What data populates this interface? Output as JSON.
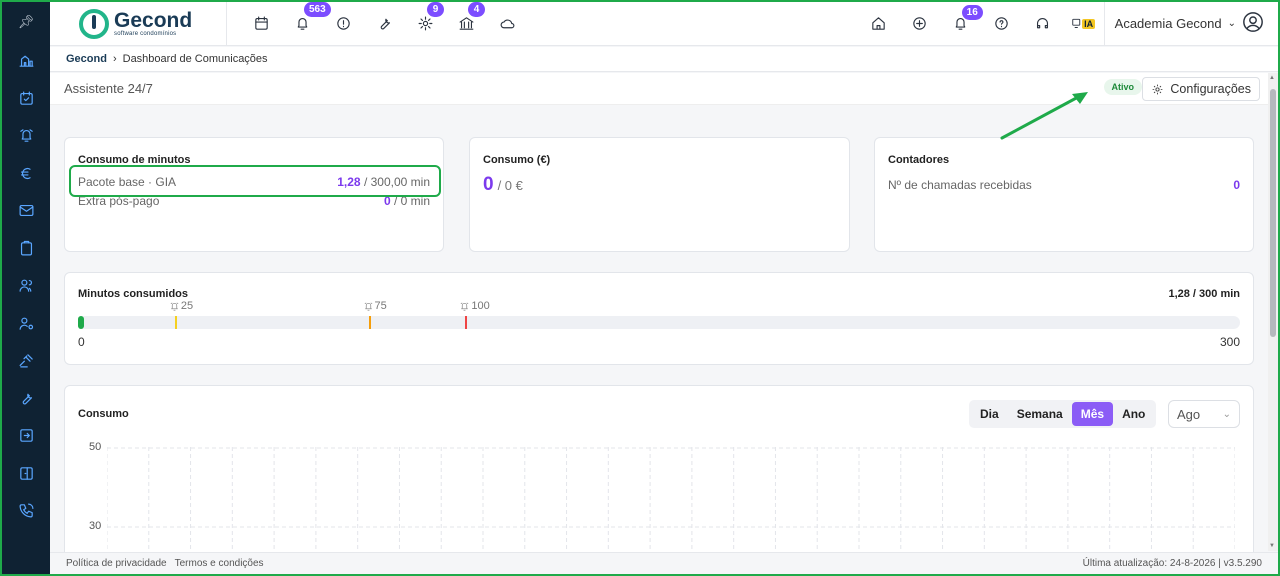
{
  "app": {
    "brand": "Gecond",
    "tagline": "software condomínios"
  },
  "topbar": {
    "badges": {
      "notifications": "563",
      "settings": "9",
      "bank": "4",
      "alerts": "16"
    },
    "ia_label": "IA",
    "account_name": "Academia Gecond"
  },
  "breadcrumb": {
    "root": "Gecond",
    "current": "Dashboard de Comunicações"
  },
  "page": {
    "title": "Assistente 24/7",
    "status": "Ativo",
    "config_label": "Configurações"
  },
  "cards": {
    "minutes": {
      "title": "Consumo de minutos",
      "rows": [
        {
          "label": "Pacote base · GIA",
          "used": "1,28",
          "total": "/ 300,00 min"
        },
        {
          "label": "Extra pós-pago",
          "used": "0",
          "total": "/ 0 min"
        }
      ]
    },
    "euro": {
      "title": "Consumo (€)",
      "value": "0",
      "total": "/ 0 €"
    },
    "counters": {
      "title": "Contadores",
      "label": "Nº de chamadas recebidas",
      "value": "0"
    }
  },
  "usage": {
    "title": "Minutos consumidos",
    "summary": "1,28 / 300 min",
    "used": 1.28,
    "max": 300,
    "min_label": "0",
    "max_label": "300",
    "thresholds": [
      {
        "value": 25,
        "label": "25",
        "color": "#f5d020"
      },
      {
        "value": 75,
        "label": "75",
        "color": "#f59e0b"
      },
      {
        "value": 100,
        "label": "100",
        "color": "#ef4444"
      }
    ]
  },
  "consumption": {
    "title": "Consumo",
    "periods": [
      "Dia",
      "Semana",
      "Mês",
      "Ano"
    ],
    "active_period": "Mês",
    "month": "Ago",
    "y_ticks": [
      "50",
      "30"
    ]
  },
  "footer": {
    "privacy": "Política de privacidade",
    "terms": "Termos e condições",
    "meta": "Última atualização: 24-8-2026 | v3.5.290"
  },
  "colors": {
    "accent": "#7c3aed",
    "sidebar": "#0f2233",
    "highlight": "#1faa4a"
  }
}
